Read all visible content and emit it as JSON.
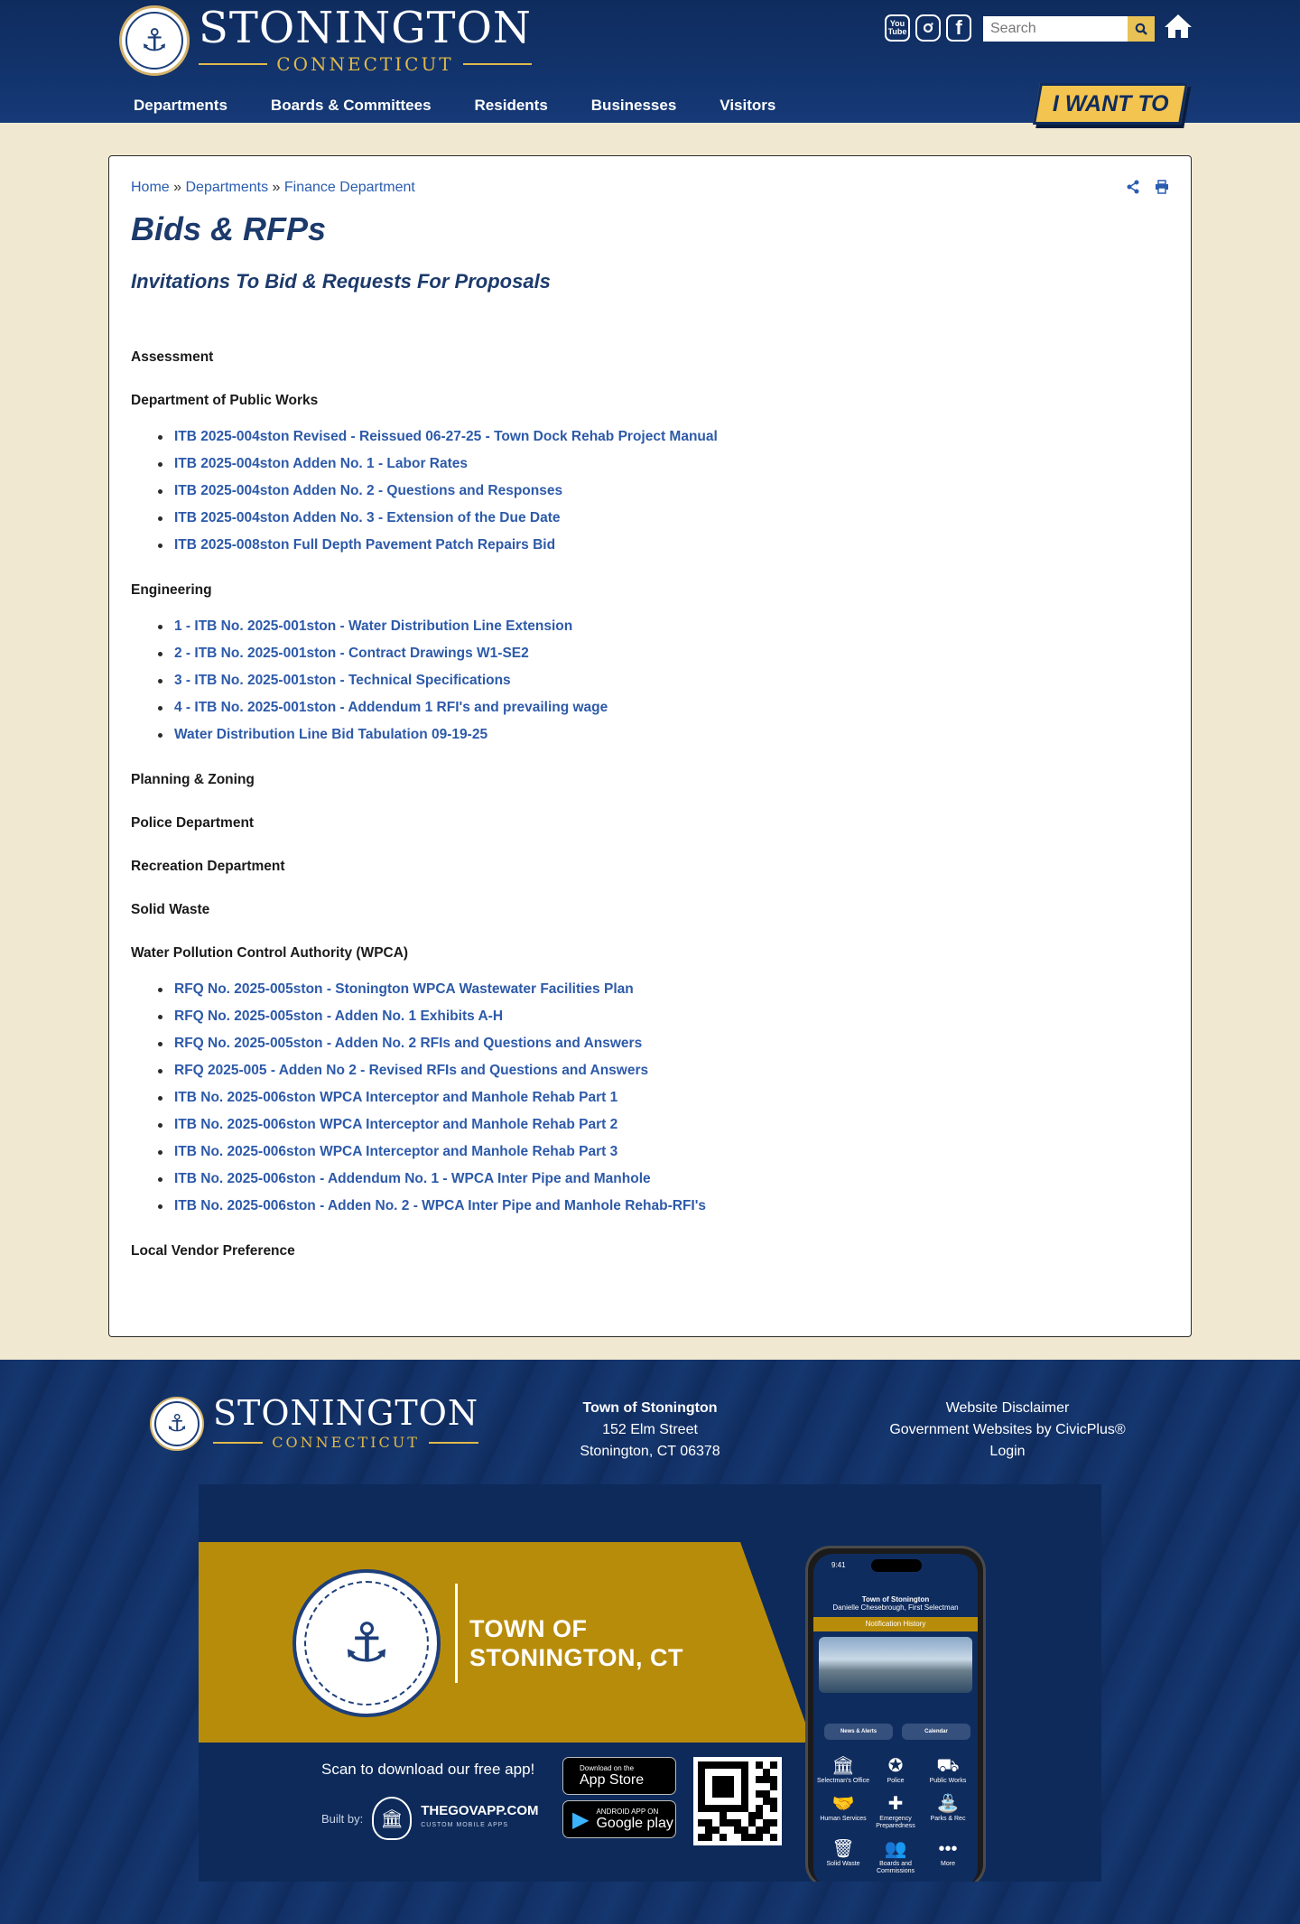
{
  "header": {
    "logo_main": "STONINGTON",
    "logo_sub": "CONNECTICUT",
    "social": [
      "youtube-icon",
      "instagram-icon",
      "facebook-icon"
    ],
    "search_placeholder": "Search",
    "nav": [
      "Departments",
      "Boards & Committees",
      "Residents",
      "Businesses",
      "Visitors"
    ],
    "i_want_to": "I WANT TO",
    "colors": {
      "navy": "#0f2c5e",
      "gold": "#f3c44f",
      "link": "#2d5aa9",
      "cream": "#f1e8d1"
    }
  },
  "breadcrumb": [
    "Home",
    "Departments",
    "Finance Department"
  ],
  "breadcrumb_sep": "»",
  "page": {
    "title": "Bids & RFPs",
    "subtitle": "Invitations To Bid & Requests For Proposals"
  },
  "sections": [
    {
      "title": "Assessment",
      "links": []
    },
    {
      "title": "Department of Public Works",
      "links": [
        "ITB 2025-004ston Revised - Reissued 06-27-25 - Town Dock Rehab Project Manual",
        "ITB 2025-004ston Adden No. 1 - Labor Rates",
        "ITB 2025-004ston Adden No. 2 - Questions and Responses",
        "ITB 2025-004ston Adden No. 3 - Extension of the Due Date",
        "ITB 2025-008ston Full Depth Pavement Patch Repairs Bid"
      ]
    },
    {
      "title": "Engineering",
      "links": [
        "1 - ITB No. 2025-001ston - Water Distribution Line Extension",
        "2 - ITB No. 2025-001ston - Contract Drawings W1-SE2",
        "3 - ITB No. 2025-001ston - Technical Specifications",
        "4 - ITB No. 2025-001ston - Addendum 1 RFI's and prevailing wage",
        "Water Distribution Line Bid Tabulation 09-19-25"
      ]
    },
    {
      "title": "Planning & Zoning",
      "links": []
    },
    {
      "title": "Police Department",
      "links": []
    },
    {
      "title": "Recreation Department",
      "links": []
    },
    {
      "title": "Solid Waste",
      "links": []
    },
    {
      "title": "Water Pollution Control Authority (WPCA)",
      "links": [
        "RFQ No. 2025-005ston - Stonington WPCA Wastewater Facilities Plan",
        "RFQ No. 2025-005ston - Adden No. 1 Exhibits A-H",
        "RFQ No. 2025-005ston - Adden No. 2 RFIs and Questions and Answers",
        "RFQ 2025-005 - Adden No 2 - Revised RFIs and Questions and Answers",
        "ITB No. 2025-006ston WPCA Interceptor and Manhole Rehab Part 1",
        "ITB No. 2025-006ston WPCA Interceptor and Manhole Rehab Part 2",
        "ITB No. 2025-006ston WPCA Interceptor and Manhole Rehab Part 3",
        "ITB No. 2025-006ston - Addendum No. 1 - WPCA Inter Pipe and Manhole",
        "ITB No. 2025-006ston - Adden No. 2 - WPCA Inter Pipe and Manhole Rehab-RFI's"
      ]
    },
    {
      "title": "Local Vendor Preference",
      "links": []
    }
  ],
  "footer": {
    "address_name": "Town of Stonington",
    "address_street": "152 Elm Street",
    "address_city": "Stonington, CT 06378",
    "links": [
      "Website Disclaimer",
      "Government Websites by CivicPlus®",
      "Login"
    ]
  },
  "app_banner": {
    "town_line1": "TOWN OF",
    "town_line2": "STONINGTON, CT",
    "scan_text": "Scan to download our free app!",
    "built_by": "Built by:",
    "gov_name": "THEGOVAPP.COM",
    "gov_tag": "CUSTOM MOBILE APPS",
    "app_store_small": "Download on the",
    "app_store": "App Store",
    "google_small": "ANDROID APP ON",
    "google": "Google play",
    "phone": {
      "time": "9:41",
      "title": "Town of Stonington",
      "subtitle": "Danielle Chesebrough, First Selectman",
      "notification": "Notification History",
      "buttons": [
        "News & Alerts",
        "Calendar"
      ],
      "tiles": [
        "Selectman's Office",
        "Police",
        "Public Works",
        "Human Services",
        "Emergency Preparedness",
        "Parks & Rec",
        "Solid Waste",
        "Boards and Commissions",
        "More"
      ]
    }
  }
}
